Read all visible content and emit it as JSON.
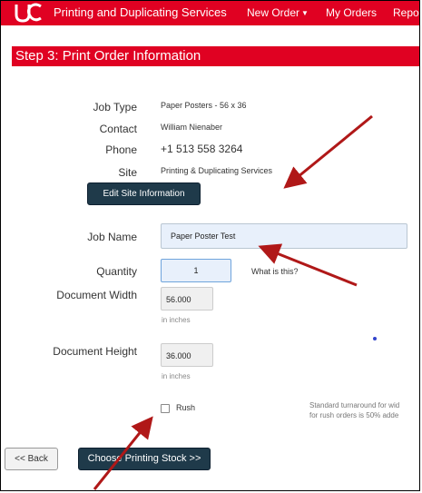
{
  "nav": {
    "brand": "Printing and Duplicating Services",
    "new_order": "New Order",
    "my_orders": "My Orders",
    "reports": "Repor"
  },
  "step": {
    "title": "Step 3: Print Order Information"
  },
  "form": {
    "job_type_label": "Job Type",
    "job_type_value": "Paper Posters - 56 x 36",
    "contact_label": "Contact",
    "contact_value": "William Nienaber",
    "phone_label": "Phone",
    "phone_value": "+1 513 558 3264",
    "site_label": "Site",
    "site_value": "Printing & Duplicating Services",
    "edit_site_button": "Edit Site Information",
    "job_name_label": "Job Name",
    "job_name_value": "Paper Poster Test",
    "quantity_label": "Quantity",
    "quantity_value": "1",
    "what_is_this": "What is this?",
    "doc_width_label": "Document Width",
    "doc_width_value": "56.000",
    "doc_width_unit": "in inches",
    "doc_height_label": "Document Height",
    "doc_height_value": "36.000",
    "doc_height_unit": "in inches",
    "rush_label": "Rush",
    "rush_note_1": "Standard turnaround for wid",
    "rush_note_2": "for rush orders is 50% adde"
  },
  "footer": {
    "back_button": "<< Back",
    "next_button": "Choose Printing Stock >>"
  },
  "colors": {
    "brand_red": "#e00122",
    "button_dark": "#1f3a4a",
    "annotation_arrow": "#b01818"
  }
}
